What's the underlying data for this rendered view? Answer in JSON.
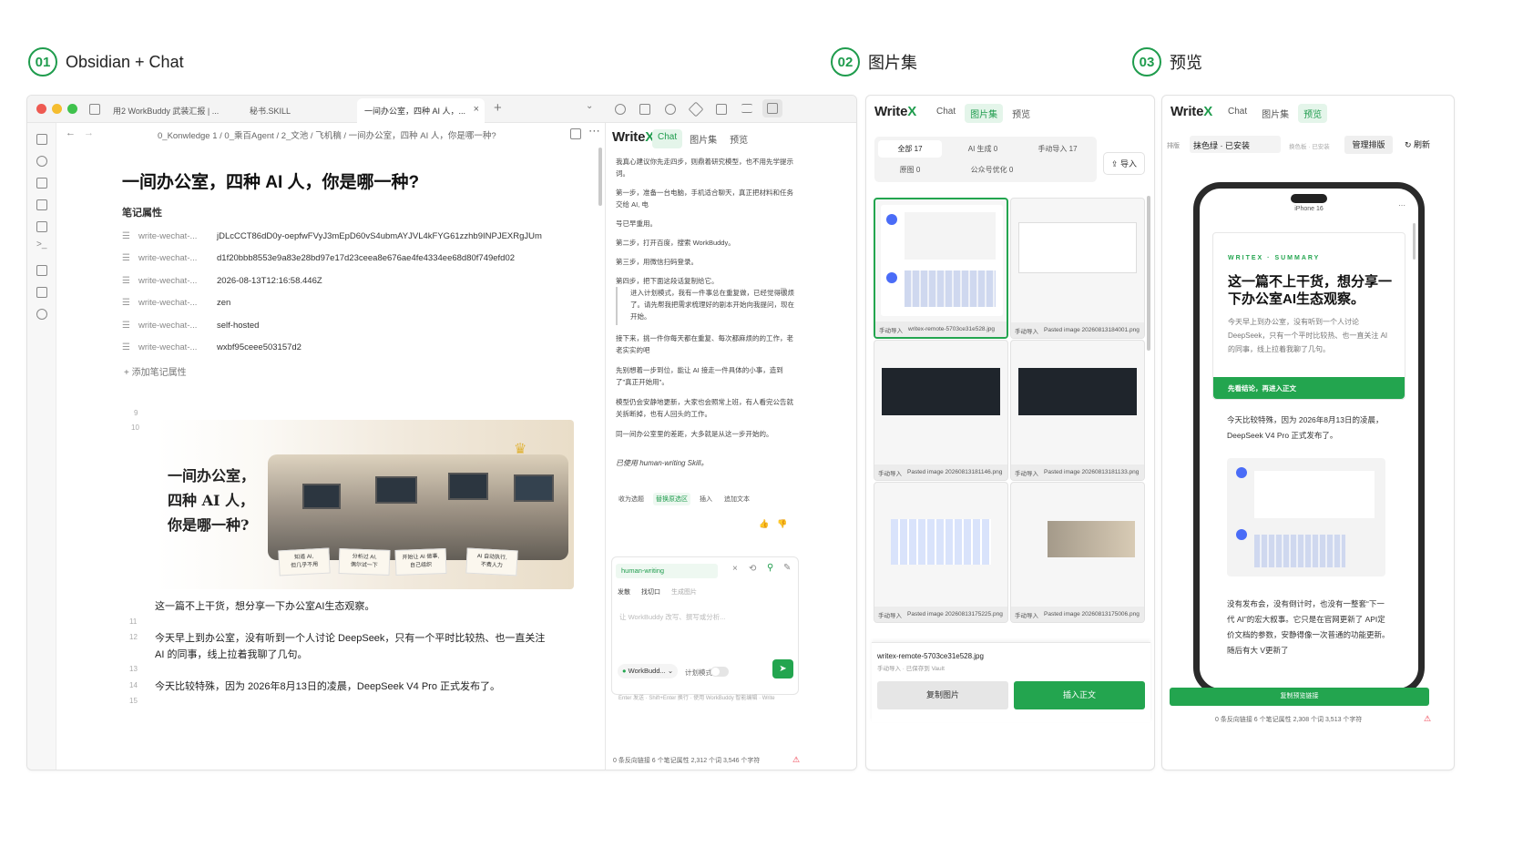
{
  "sections": [
    {
      "num": "01",
      "title": "Obsidian + Chat"
    },
    {
      "num": "02",
      "title": "图片集"
    },
    {
      "num": "03",
      "title": "预览"
    }
  ],
  "obsidian": {
    "tabs": [
      "用2 WorkBuddy 武装汇报 | ...",
      "秘书.SKILL",
      "一间办公室，四种 AI 人，..."
    ],
    "breadcrumb": "0_Konwledge 1  /  0_乘百Agent  /  2_文池  /  飞机稿  /  一间办公室，四种 AI 人，你是哪一种?",
    "title": "一间办公室，四种 AI 人，你是哪一种?",
    "props_heading": "笔记属性",
    "props": [
      {
        "k": "write-wechat-...",
        "v": "jDLcCCT86dD0y-oepfwFVyJ3mEpD60vS4ubmAYJVL4kFYG61zzhb9INPJEXRgJUm"
      },
      {
        "k": "write-wechat-...",
        "v": "d1f20bbb8553e9a83e28bd97e17d23ceea8e676ae4fe4334ee68d80f749efd02"
      },
      {
        "k": "write-wechat-...",
        "v": "2026-08-13T12:16:58.446Z"
      },
      {
        "k": "write-wechat-...",
        "v": "zen"
      },
      {
        "k": "write-wechat-...",
        "v": "self-hosted"
      },
      {
        "k": "write-wechat-...",
        "v": "wxbf95ceee503157d2"
      }
    ],
    "add_prop": "+ 添加笔记属性",
    "line9": "9",
    "line10": "10",
    "cover_text": [
      "一间办公室，",
      "四种 AI 人，",
      "你是哪一种?"
    ],
    "cards": [
      "知道 AI,\n但几乎不用",
      "分析过 AI,\n偶尔试一下",
      "开始让 AI 做事,\n自己组织",
      "AI 自动执行,\n不费人力"
    ],
    "body": [
      {
        "ln": "",
        "t": "这一篇不上干货，想分享一下办公室AI生态观察。"
      },
      {
        "ln": "11",
        "t": ""
      },
      {
        "ln": "12",
        "t": "今天早上到办公室，没有听到一个人讨论 DeepSeek，只有一个平时比较热、也一直关注"
      },
      {
        "ln": "",
        "t": "AI 的同事，线上拉着我聊了几句。"
      },
      {
        "ln": "13",
        "t": ""
      },
      {
        "ln": "14",
        "t": "今天比较特殊，因为 2026年8月13日的凌晨，DeepSeek V4 Pro 正式发布了。"
      },
      {
        "ln": "15",
        "t": ""
      }
    ]
  },
  "chat": {
    "tabs": [
      "Chat",
      "图片集",
      "预览"
    ],
    "msgs": [
      "我真心建议你先走四步，则鼎着研究模型，也不用先学提示词。",
      "第一步，准备一台电脑，手机适合聊天，真正把材料和任务交给 AI, 电",
      "号已早重用。",
      "第二步，打开百度，搜索 WorkBuddy。",
      "第三步，用微信扫码登录。",
      "第四步，把下面这段话复制给它。"
    ],
    "quote": "进入计划模式，我有一件事总在重复做，已经觉得很烦了。请先帮我把需求梳理好的剧本开始向我提问，现在开始。",
    "msgs2": [
      "接下来，挑一件你每天都在重复、每次都麻烦的的工作，老老实实的吧",
      "先别想着一步到位，能让 AI 接走一件具体的小事，造到了\"真正开始用\"。",
      "模型仍会安静地更新，大家也会照常上班，有人看完公告就关拆断掉，也有人回头的工作。",
      "同一间办公室里的差距，大多就是从这一步开始的。"
    ],
    "used": "已使用 human-writing Skill。",
    "actions": [
      "收为选题",
      "替换原选区",
      "插入",
      "追加文本"
    ],
    "skill": "human-writing",
    "modes": [
      "发散",
      "找切口",
      "生成图片"
    ],
    "placeholder": "让 WorkBuddy 改写、撰写或分析...",
    "agent": "WorkBudd...",
    "plan": "计划模式",
    "hint": "Enter 发送 · Shift+Enter 换行 · 使用 WorkBuddy 智能编辑 · Write"
  },
  "status_left": "0 条反向链接   6 个笔记属性   2,312 个词  3,546 个字符",
  "gallery": {
    "tabs": [
      "Chat",
      "图片集",
      "预览"
    ],
    "filters": [
      "全部 17",
      "AI 生成 0",
      "手动导入 17",
      "原图 0",
      "公众号优化 0"
    ],
    "import": "导入",
    "thumbs": [
      {
        "tag": "手动导入",
        "name": "writex-remote-5703ce31e528.jpg"
      },
      {
        "tag": "手动导入",
        "name": "Pasted image 20260813184001.png"
      },
      {
        "tag": "手动导入",
        "name": "Pasted image 20260813181146.png"
      },
      {
        "tag": "手动导入",
        "name": "Pasted image 20260813181133.png"
      },
      {
        "tag": "手动导入",
        "name": "Pasted image 20260813175225.png"
      },
      {
        "tag": "手动导入",
        "name": "Pasted image 20260813175006.png"
      }
    ],
    "selected_name": "writex-remote-5703ce31e528.jpg",
    "selected_sub": "手动导入 · 已保存到 Vault",
    "copy": "复制图片",
    "insert": "插入正文"
  },
  "preview": {
    "tabs": [
      "Chat",
      "图片集",
      "预览"
    ],
    "layout_label": "排版",
    "theme": "抹色绿 · 已安装",
    "theme_hint": "换色板 · 已安装",
    "manage": "管理排版",
    "refresh": "刷新",
    "device": "iPhone 16",
    "brand": "WRITEX · SUMMARY",
    "summary_title": "这一篇不上干货，想分享一下办公室AI生态观察。",
    "summary_body": "今天早上到办公室，没有听到一个人讨论 DeepSeek，只有一个平时比较热、也一直关注 AI 的同事，线上拉着我聊了几句。",
    "summary_btn": "先看结论，再进入正文",
    "p1": "今天比较特殊，因为 2026年8月13日的凌晨，DeepSeek V4 Pro 正式发布了。",
    "p2": "没有发布会，没有倒计时，也没有一整套“下一代 AI”的宏大叙事。它只是在官网更新了 API定价文档的参数，安静得像一次普通的功能更新。随后有大 V更新了",
    "copy": "复制预览链接",
    "status": "0 条反向链接   6 个笔记属性   2,308 个词  3,513 个字符"
  }
}
